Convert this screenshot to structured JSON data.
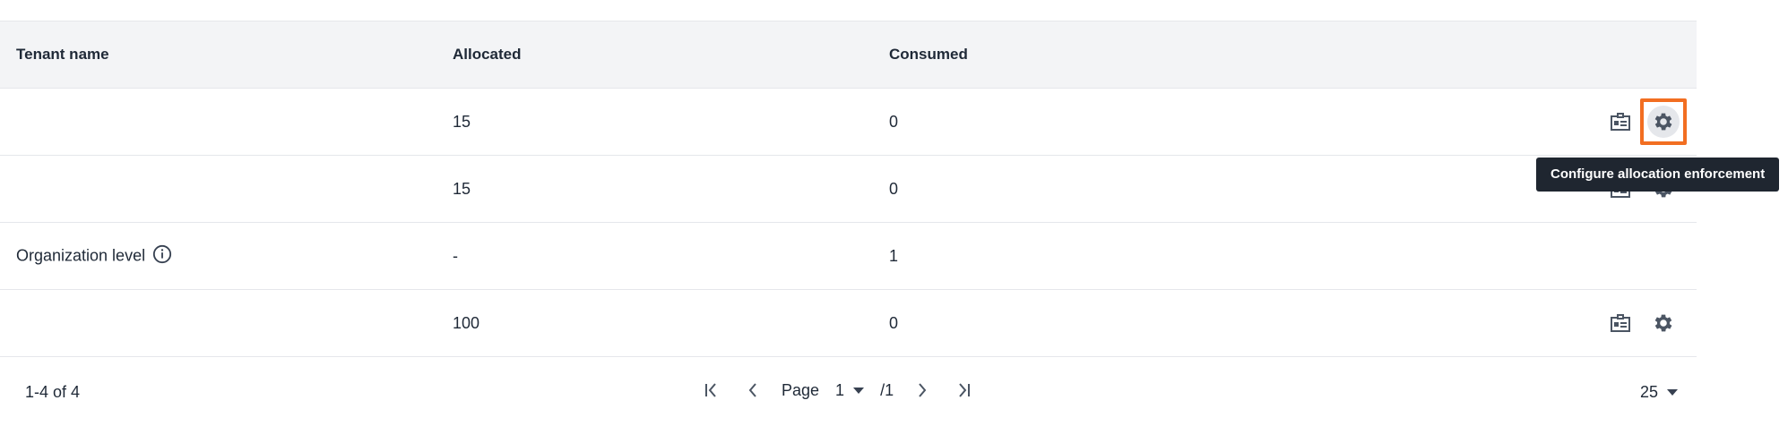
{
  "table": {
    "headers": [
      "Tenant name",
      "Allocated",
      "Consumed"
    ],
    "rows": [
      {
        "tenant": "",
        "allocated": "15",
        "consumed": "0"
      },
      {
        "tenant": "",
        "allocated": "15",
        "consumed": "0"
      },
      {
        "tenant": "Organization level",
        "allocated": "-",
        "consumed": "1"
      },
      {
        "tenant": "",
        "allocated": "100",
        "consumed": "0"
      }
    ]
  },
  "tooltip": {
    "text": "Configure allocation enforcement"
  },
  "footer": {
    "range": "1-4 of 4",
    "page_label": "Page",
    "page_value": "1",
    "page_total": "/1",
    "page_size": "25"
  },
  "colors": {
    "highlight": "#f26e21",
    "tooltip_bg": "#1f2630",
    "header_bg": "#f3f4f6"
  },
  "icons": [
    "id-card-icon",
    "gear-icon",
    "info-icon",
    "first-page-icon",
    "prev-page-icon",
    "next-page-icon",
    "last-page-icon",
    "chevron-down-icon"
  ]
}
